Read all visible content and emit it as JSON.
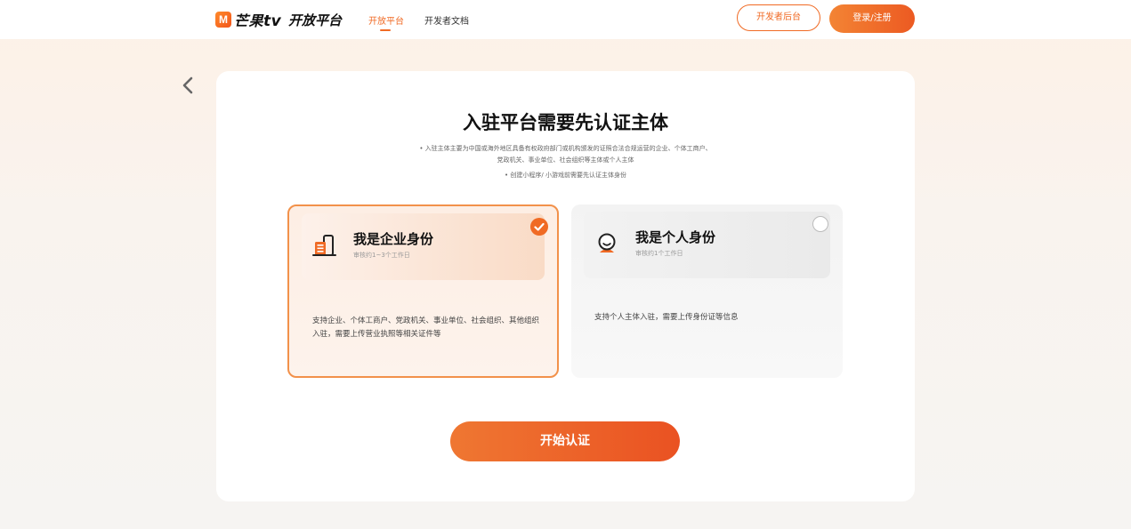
{
  "header": {
    "logo_mark": "M",
    "logo_name": "芒果",
    "logo_tv": "tv",
    "platform_title": "开放平台",
    "nav": [
      {
        "label": "开放平台",
        "active": true
      },
      {
        "label": "开发者文档",
        "active": false
      }
    ],
    "dev_console_label": "开发者后台",
    "login_label": "登录/注册"
  },
  "main": {
    "back_icon": "chevron-left-icon",
    "title": "入驻平台需要先认证主体",
    "desc_lines": [
      "• 入驻主体主要为中国或海外地区具备有权政府部门或机构颁发的证照合法合规运营的企业、个体工商户、",
      "党政机关、事业单位、社会组织等主体或个人主体",
      "• 创建小程序/ 小游戏前需要先认证主体身份"
    ],
    "cards": [
      {
        "name": "我是企业身份",
        "sub": "审核约1~3个工作日",
        "text": "支持企业、个体工商户、党政机关、事业单位、社会组织、其他组织入驻，需要上传营业执照等相关证件等",
        "selected": true,
        "icon": "building-icon"
      },
      {
        "name": "我是个人身份",
        "sub": "审核约1个工作日",
        "text": "支持个人主体入驻，需要上传身份证等信息",
        "selected": false,
        "icon": "person-icon"
      }
    ],
    "start_label": "开始认证"
  },
  "colors": {
    "accent": "#f06a24",
    "accent_dark": "#ea5222"
  }
}
